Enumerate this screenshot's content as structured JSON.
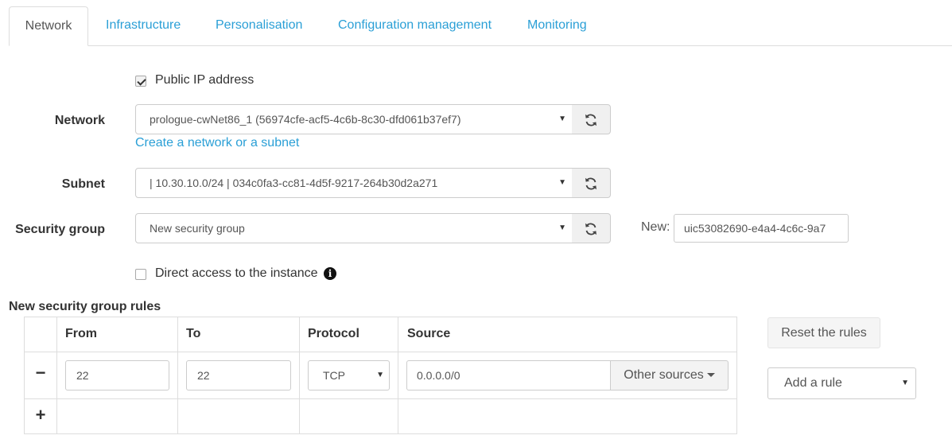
{
  "tabs": [
    {
      "label": "Network",
      "active": true
    },
    {
      "label": "Infrastructure",
      "active": false
    },
    {
      "label": "Personalisation",
      "active": false
    },
    {
      "label": "Configuration management",
      "active": false
    },
    {
      "label": "Monitoring",
      "active": false
    }
  ],
  "public_ip": {
    "label": "Public IP address",
    "checked": true
  },
  "network": {
    "label": "Network",
    "value": "prologue-cwNet86_1 (56974cfe-acf5-4c6b-8c30-dfd061b37ef7)",
    "create_link": "Create a network or a subnet"
  },
  "subnet": {
    "label": "Subnet",
    "value": "| 10.30.10.0/24 | 034c0fa3-cc81-4d5f-9217-264b30d2a271"
  },
  "security_group": {
    "label": "Security group",
    "value": "New security group",
    "new_label": "New:",
    "new_value": "uic53082690-e4a4-4c6c-9a7"
  },
  "direct_access": {
    "label": "Direct access to the instance",
    "checked": false,
    "info_icon": "info-circle-icon"
  },
  "rules": {
    "title": "New security group rules",
    "columns": [
      "From",
      "To",
      "Protocol",
      "Source"
    ],
    "rows": [
      {
        "remove": "−",
        "from": "22",
        "to": "22",
        "protocol": "TCP",
        "source": "0.0.0.0/0",
        "other_sources": "Other sources"
      }
    ],
    "add_row": "+",
    "reset_button": "Reset the rules",
    "add_rule": "Add a rule"
  },
  "colors": {
    "link": "#2a9fd6",
    "border": "#dddddd",
    "text": "#333333"
  }
}
